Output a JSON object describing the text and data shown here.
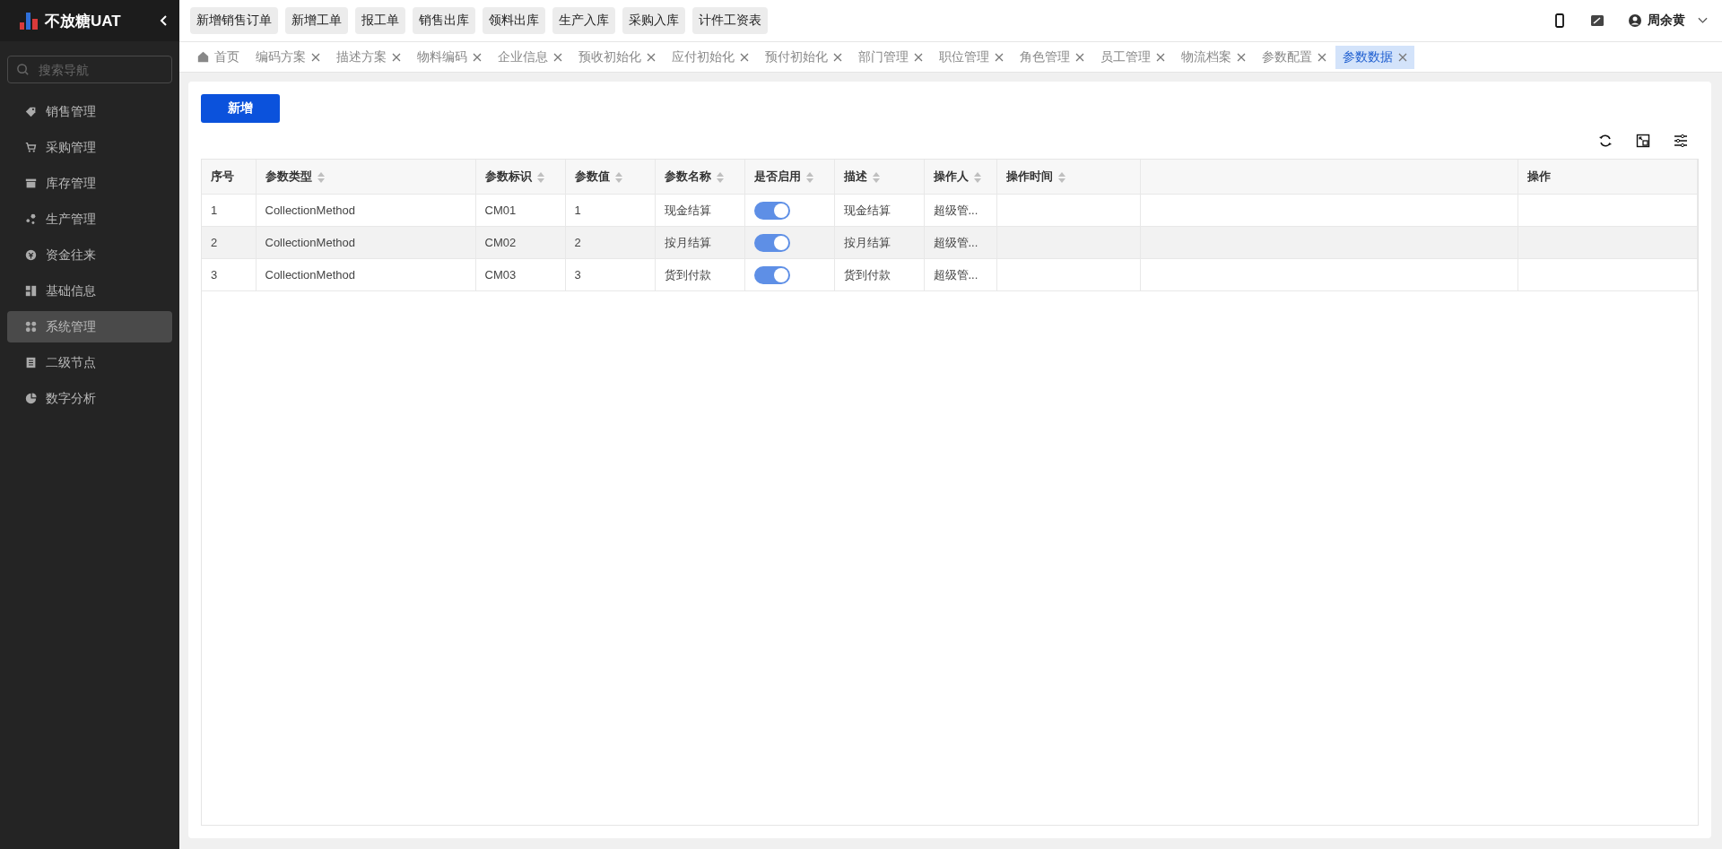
{
  "brand": {
    "name": "不放糖UAT"
  },
  "sidebar": {
    "search": {
      "placeholder": "搜索导航"
    },
    "items": [
      {
        "label": "销售管理",
        "selected": false
      },
      {
        "label": "采购管理",
        "selected": false
      },
      {
        "label": "库存管理",
        "selected": false
      },
      {
        "label": "生产管理",
        "selected": false
      },
      {
        "label": "资金往来",
        "selected": false
      },
      {
        "label": "基础信息",
        "selected": false
      },
      {
        "label": "系统管理",
        "selected": true
      },
      {
        "label": "二级节点",
        "selected": false
      },
      {
        "label": "数字分析",
        "selected": false
      }
    ]
  },
  "quick_links": [
    "新增销售订单",
    "新增工单",
    "报工单",
    "销售出库",
    "领料出库",
    "生产入库",
    "采购入库",
    "计件工资表"
  ],
  "user": {
    "name": "周余黄"
  },
  "tabs": [
    {
      "label": "首页",
      "closable": false,
      "selected": false
    },
    {
      "label": "编码方案",
      "closable": true,
      "selected": false
    },
    {
      "label": "描述方案",
      "closable": true,
      "selected": false
    },
    {
      "label": "物料编码",
      "closable": true,
      "selected": false
    },
    {
      "label": "企业信息",
      "closable": true,
      "selected": false
    },
    {
      "label": "预收初始化",
      "closable": true,
      "selected": false
    },
    {
      "label": "应付初始化",
      "closable": true,
      "selected": false
    },
    {
      "label": "预付初始化",
      "closable": true,
      "selected": false
    },
    {
      "label": "部门管理",
      "closable": true,
      "selected": false
    },
    {
      "label": "职位管理",
      "closable": true,
      "selected": false
    },
    {
      "label": "角色管理",
      "closable": true,
      "selected": false
    },
    {
      "label": "员工管理",
      "closable": true,
      "selected": false
    },
    {
      "label": "物流档案",
      "closable": true,
      "selected": false
    },
    {
      "label": "参数配置",
      "closable": true,
      "selected": false
    },
    {
      "label": "参数数据",
      "closable": true,
      "selected": true
    }
  ],
  "add_button": "新增",
  "table": {
    "columns": [
      {
        "label": "序号",
        "sortable": false
      },
      {
        "label": "参数类型",
        "sortable": true
      },
      {
        "label": "参数标识",
        "sortable": true
      },
      {
        "label": "参数值",
        "sortable": true
      },
      {
        "label": "参数名称",
        "sortable": true
      },
      {
        "label": "是否启用",
        "sortable": true
      },
      {
        "label": "描述",
        "sortable": true
      },
      {
        "label": "操作人",
        "sortable": true
      },
      {
        "label": "操作时间",
        "sortable": true
      },
      {
        "sortable": false
      },
      {
        "label": "操作",
        "sortable": false
      }
    ],
    "rows": [
      {
        "index": "1",
        "type": "CollectionMethod",
        "key": "CM01",
        "value": "1",
        "name": "现金结算",
        "enabled": true,
        "description": "现金结算",
        "operator": "超级管...",
        "highlighted": false
      },
      {
        "index": "2",
        "type": "CollectionMethod",
        "key": "CM02",
        "value": "2",
        "name": "按月结算",
        "enabled": true,
        "description": "按月结算",
        "operator": "超级管...",
        "highlighted": true
      },
      {
        "index": "3",
        "type": "CollectionMethod",
        "key": "CM03",
        "value": "3",
        "name": "货到付款",
        "enabled": true,
        "description": "货到付款",
        "operator": "超级管...",
        "highlighted": false
      }
    ]
  }
}
